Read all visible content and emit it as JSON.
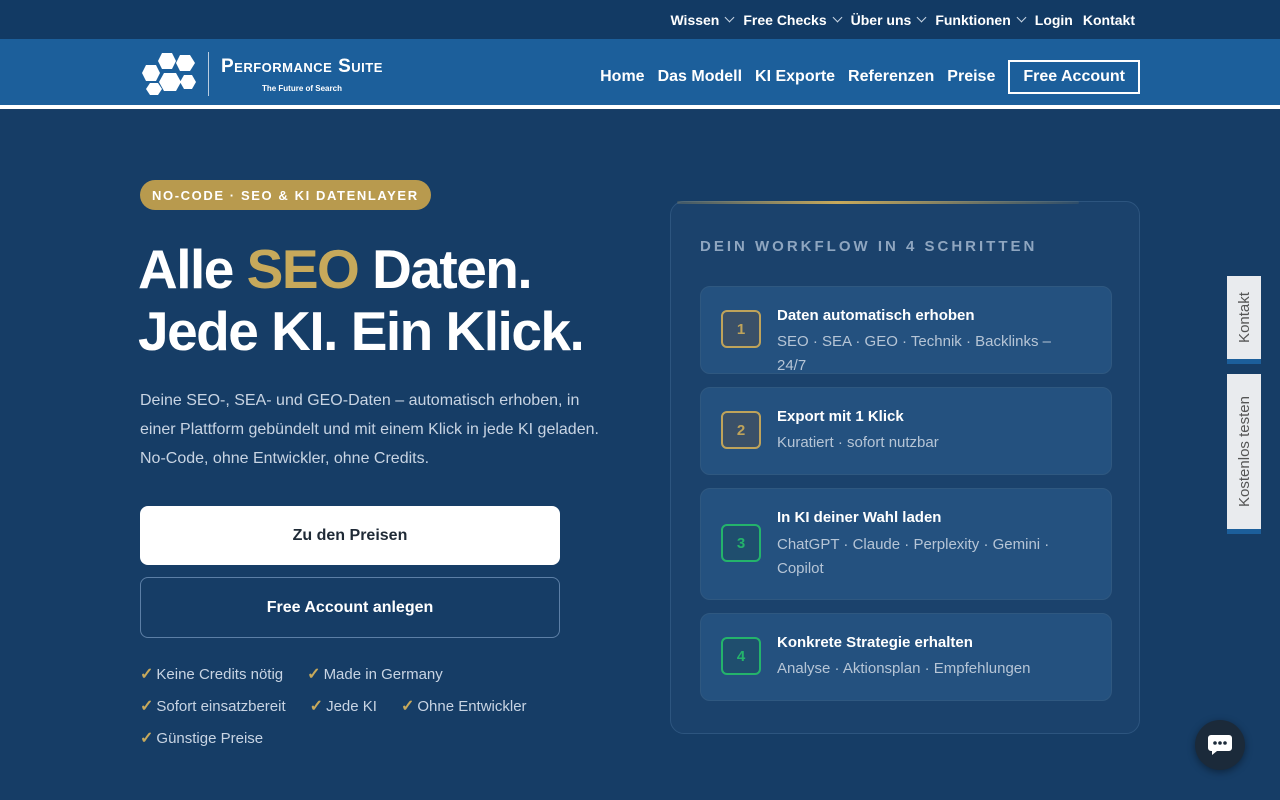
{
  "topnav": {
    "items": [
      {
        "label": "Wissen",
        "dropdown": true
      },
      {
        "label": "Free Checks",
        "dropdown": true
      },
      {
        "label": "Über uns",
        "dropdown": true
      },
      {
        "label": "Funktionen",
        "dropdown": true
      },
      {
        "label": "Login",
        "dropdown": false
      },
      {
        "label": "Kontakt",
        "dropdown": false
      }
    ]
  },
  "brand": {
    "name": "Performance Suite",
    "tagline": "The Future of Search"
  },
  "mainnav": {
    "items": [
      "Home",
      "Das Modell",
      "KI Exporte",
      "Referenzen",
      "Preise"
    ],
    "cta": "Free Account"
  },
  "hero": {
    "badge": "NO-CODE · SEO & KI DATENLAYER",
    "headline_part1": "Alle ",
    "headline_accent": "SEO",
    "headline_part2": " Daten.",
    "headline_line2": "Jede KI. Ein Klick.",
    "lead": "Deine SEO-, SEA- und GEO-Daten – automatisch erhoben, in einer Plattform gebündelt und mit einem Klick in jede KI geladen. No-Code, ohne Entwickler, ohne Credits.",
    "primary_button": "Zu den Preisen",
    "secondary_button": "Free Account anlegen",
    "checks": [
      "Keine Credits nötig",
      "Made in Germany",
      "Sofort einsatzbereit",
      "Jede KI",
      "Ohne Entwickler",
      "Günstige Preise"
    ]
  },
  "workflow": {
    "title": "DEIN WORKFLOW IN 4 SCHRITTEN",
    "steps": [
      {
        "number": "1",
        "title": "Daten automatisch erhoben",
        "subtitle": "SEO · SEA · GEO · Technik · Backlinks – 24/7",
        "status_color": "gold"
      },
      {
        "number": "2",
        "title": "Export mit 1 Klick",
        "subtitle": "Kuratiert · sofort nutzbar",
        "status_color": "gold"
      },
      {
        "number": "3",
        "title": "In KI deiner Wahl laden",
        "subtitle": "ChatGPT · Claude · Perplexity · Gemini · Copilot",
        "status_color": "green"
      },
      {
        "number": "4",
        "title": "Konkrete Strategie erhalten",
        "subtitle": "Analyse · Aktionsplan · Empfehlungen",
        "status_color": "green"
      }
    ]
  },
  "side_tabs": {
    "contact": "Kontakt",
    "trial": "Kostenlos testen"
  },
  "colors": {
    "background": "#163d66",
    "accent_gold": "#c7a95b",
    "nav_blue": "#1c5f9b",
    "step_green": "#24b36b"
  },
  "icons": {
    "chat": "chat-bubble-icon",
    "dropdown": "chevron-down-icon"
  }
}
